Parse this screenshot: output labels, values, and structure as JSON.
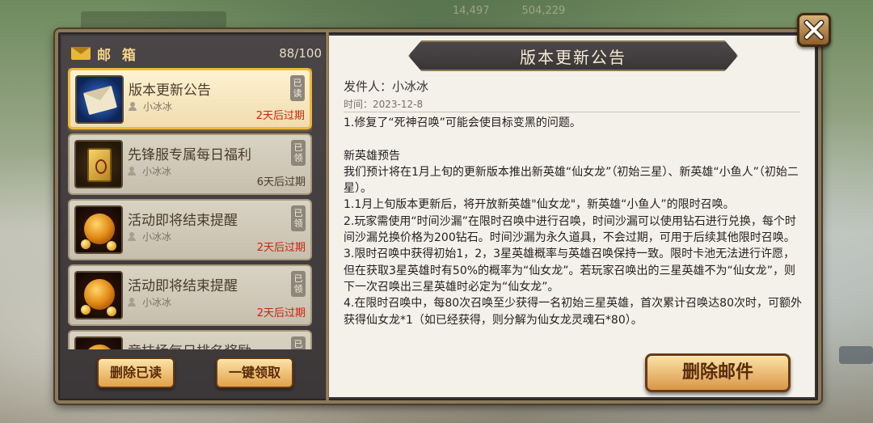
{
  "mailbox": {
    "title": "邮 箱",
    "count": "88/100",
    "items": [
      {
        "name": "版本更新公告",
        "sender": "小冰冰",
        "expiry": "2天后过期",
        "status": "已读",
        "thumb": "envelope-icon"
      },
      {
        "name": "先锋服专属每日福利",
        "sender": "小冰冰",
        "expiry": "6天后过期",
        "status": "已领",
        "thumb": "gold-card-icon"
      },
      {
        "name": "活动即将结束提醒",
        "sender": "小冰冰",
        "expiry": "2天后过期",
        "status": "已领",
        "thumb": "gold-bag-icon"
      },
      {
        "name": "活动即将结束提醒",
        "sender": "小冰冰",
        "expiry": "2天后过期",
        "status": "已领",
        "thumb": "gold-bag-icon"
      },
      {
        "name": "竞技场每日排名奖励",
        "sender": "",
        "expiry": "",
        "status": "已领",
        "thumb": "gold-bag-icon"
      }
    ],
    "delete_read_label": "删除已读",
    "claim_all_label": "一键领取"
  },
  "detail": {
    "title": "版本更新公告",
    "sender_line": "发件人：小冰冰",
    "time_line": "时间：2023-12-8",
    "body": "1.修复了“死神召唤”可能会使目标变黑的问题。\n\n新英雄预告\n我们预计将在1月上旬的更新版本推出新英雄“仙女龙”（初始三星）、新英雄“小鱼人”（初始二星）。\n1.1月上旬版本更新后，将开放新英雄\"仙女龙\"，新英雄“小鱼人”的限时召唤。\n2.玩家需使用“时间沙漏”在限时召唤中进行召唤，时间沙漏可以使用钻石进行兑换，每个时间沙漏兑换价格为200钻石。时间沙漏为永久道具，不会过期，可用于后续其他限时召唤。\n3.限时召唤中获得初始1，2，3星英雄概率与英雄召唤保持一致。限时卡池无法进行许愿，但在获取3星英雄时有50%的概率为“仙女龙”。若玩家召唤出的三星英雄不为“仙女龙”，则下一次召唤出三星英雄时必定为“仙女龙”。\n4.在限时召唤中，每80次召唤至少获得一名初始三星英雄，首次累计召唤达80次时，可额外获得仙女龙*1（如已经获得，则分解为仙女龙灵魂石*80）。",
    "delete_label": "删除邮件"
  },
  "background": {
    "top_values": [
      "14,497",
      "504,229"
    ]
  }
}
